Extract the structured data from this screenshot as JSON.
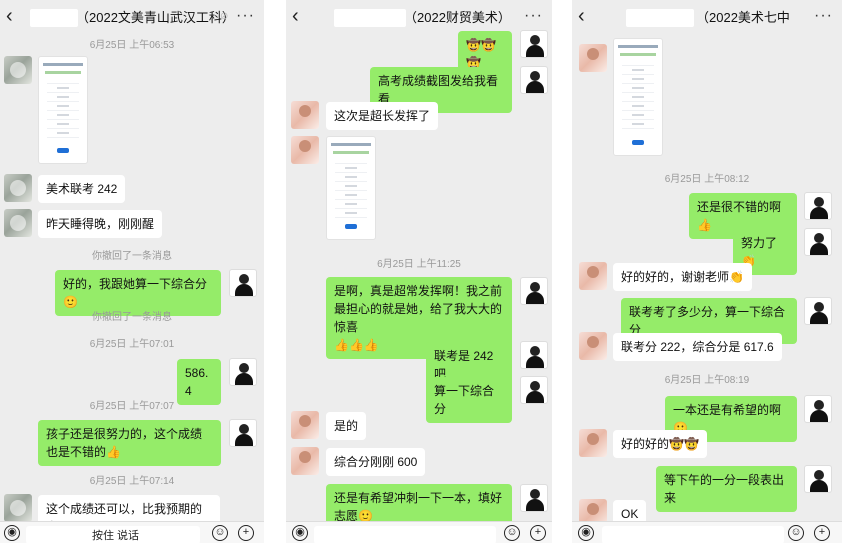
{
  "panel1": {
    "title": "（2022文美青山武汉工科）",
    "mute_icon": "mute-icon",
    "ts1": "6月25日 上午06:53",
    "msg1": "美术联考 242",
    "msg2": "昨天睡得晚，刚刚醒",
    "recall1": "你撤回了一条消息",
    "msg3_text": "好的，我跟她算一下综合分",
    "msg3_emoji": "🙂",
    "recall2": "你撤回了一条消息",
    "ts2": "6月25日 上午07:01",
    "msg4": "586.4",
    "ts3": "6月25日 上午07:07",
    "msg5_text": "孩子还是很努力的，这个成绩也是不错的",
    "msg5_emoji": "👍",
    "ts4": "6月25日 上午07:14",
    "msg6_text": "这个成绩还可以，比我预期的高",
    "msg6_emoji": "😘",
    "msg6_line2": "😄😄",
    "input_partial": "按住 说话"
  },
  "panel2": {
    "title": "（2022财贸美术）",
    "msg1": "🤠🤠🤠",
    "msg2": "高考成绩截图发给我看看",
    "msg3": "这次是超长发挥了",
    "ts1": "6月25日 上午11:25",
    "msg4_text": "是啊，真是超常发挥啊！我之前最担心的就是她，给了我大大的惊喜",
    "msg4_emoji": "👍👍👍",
    "msg5": "联考是 242 吧",
    "msg6": "算一下综合分",
    "msg7": "是的",
    "msg8": "综合分刚刚 600",
    "msg9_text": "还是有希望冲刺一下一本，填好志愿",
    "msg9_emoji": "🙂"
  },
  "panel3": {
    "title": "（2022美术七中",
    "ts1": "6月25日 上午08:12",
    "msg1_text": "还是很不错的啊",
    "msg1_emoji": "👍",
    "msg2_text": "努力了",
    "msg2_emoji": "👏",
    "msg3_text": "好的好的，谢谢老师",
    "msg3_emoji": "👏",
    "msg4": "联考考了多少分，算一下综合分",
    "msg5": "联考分 222，综合分是 617.6",
    "ts2": "6月25日 上午08:19",
    "msg6_text": "一本还是有希望的啊",
    "msg6_emoji": "🙂",
    "msg7_text": "好的好的",
    "msg7_emoji": "🤠🤠",
    "msg8": "等下午的一分一段表出来",
    "msg9": "OK"
  },
  "common": {
    "back_icon": "‹",
    "more_icon": "···",
    "voice_icon": "voice-icon",
    "emoji_icon": "emoji-icon",
    "plus_icon": "plus-icon",
    "brand_green": "#95ec69",
    "bg_gray": "#ededed"
  }
}
